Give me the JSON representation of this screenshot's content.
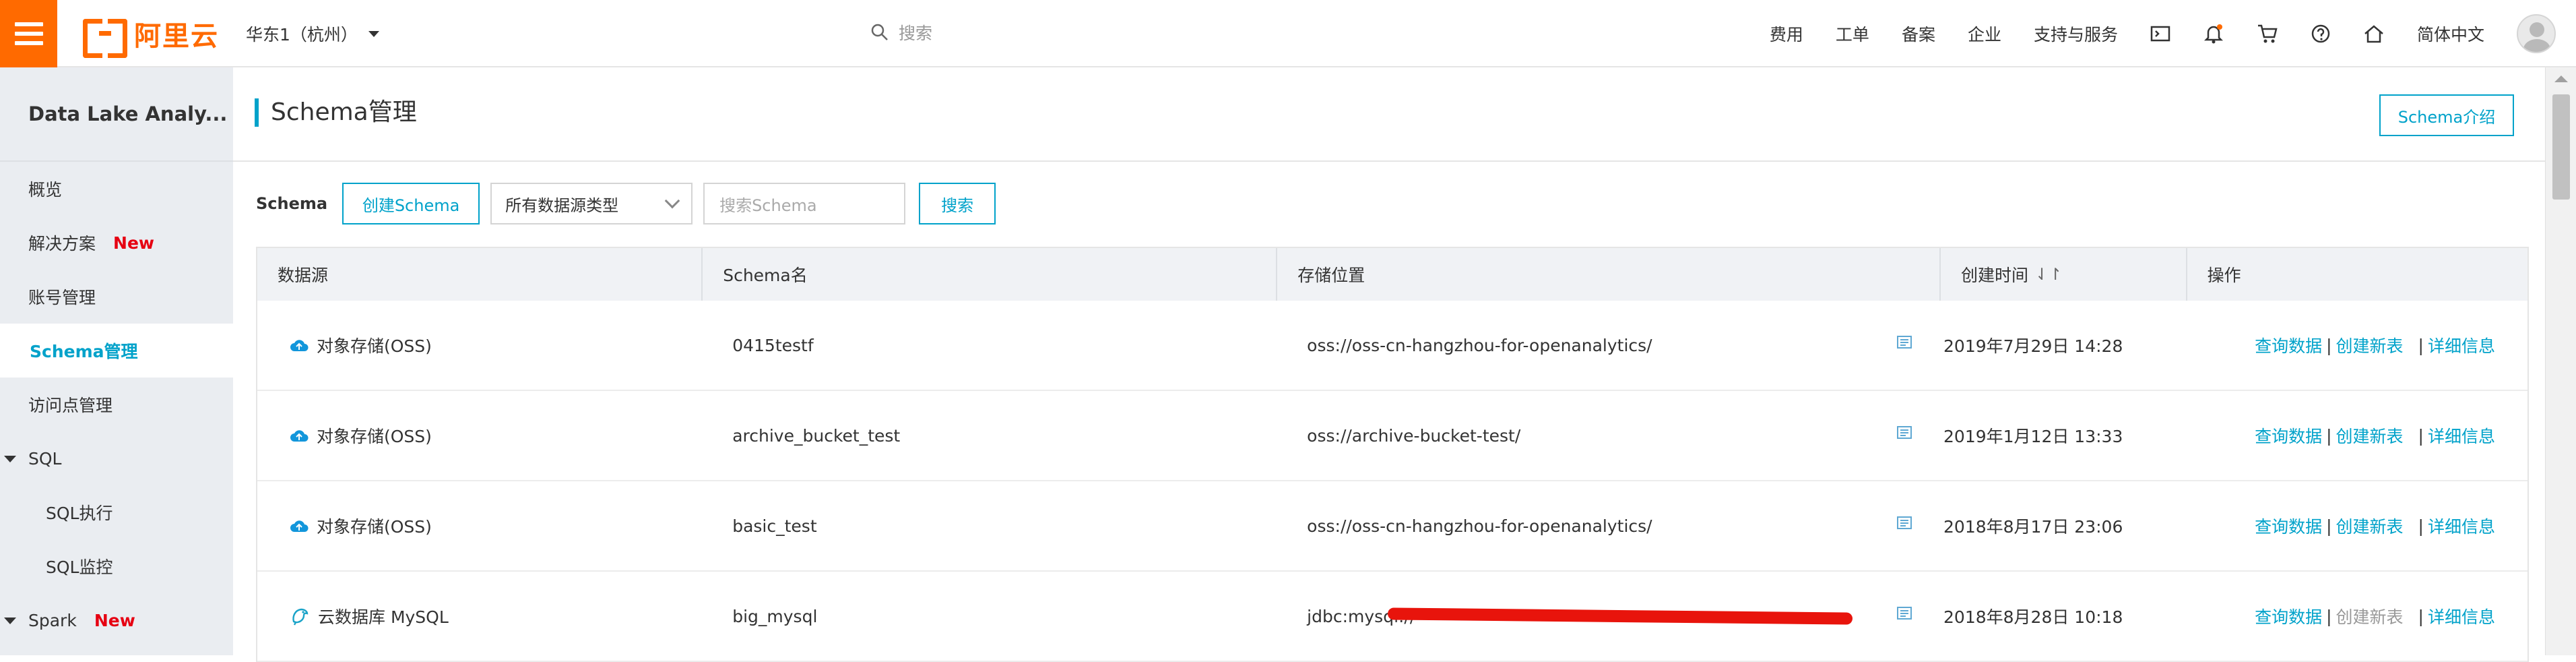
{
  "topbar": {
    "logo_text": "阿里云",
    "region": "华东1（杭州）",
    "search_placeholder": "搜索",
    "nav": [
      "费用",
      "工单",
      "备案",
      "企业",
      "支持与服务"
    ],
    "language": "简体中文",
    "brand_color": "#ff6a00"
  },
  "sidebar": {
    "title": "Data Lake Analy...",
    "items": [
      {
        "label": "概览"
      },
      {
        "label": "解决方案",
        "badge": "New"
      },
      {
        "label": "账号管理"
      },
      {
        "label": "Schema管理",
        "active": true
      },
      {
        "label": "访问点管理"
      },
      {
        "label": "SQL",
        "group": true
      },
      {
        "label": "SQL执行"
      },
      {
        "label": "SQL监控"
      },
      {
        "label": "Spark",
        "group": true,
        "badge": "New"
      }
    ]
  },
  "main": {
    "title": "Schema管理",
    "intro_button": "Schema介绍",
    "toolbar": {
      "label": "Schema",
      "create_button": "创建Schema",
      "type_select": "所有数据源类型",
      "search_placeholder": "搜索Schema",
      "search_button": "搜索"
    },
    "table": {
      "columns": [
        "数据源",
        "Schema名",
        "存储位置",
        "创建时间",
        "操作"
      ],
      "sort_icon": "⇃↾",
      "rows": [
        {
          "source": "对象存储(OSS)",
          "source_icon": "oss-cloud-icon",
          "schema": "0415testf",
          "location": "oss://oss-cn-hangzhou-for-openanalytics/",
          "created": "2019年7月29日 14:28",
          "actions": [
            "查询数据",
            "创建新表",
            "详细信息"
          ]
        },
        {
          "source": "对象存储(OSS)",
          "source_icon": "oss-cloud-icon",
          "schema": "archive_bucket_test",
          "location": "oss://archive-bucket-test/",
          "created": "2019年1月12日 13:33",
          "actions": [
            "查询数据",
            "创建新表",
            "详细信息"
          ]
        },
        {
          "source": "对象存储(OSS)",
          "source_icon": "oss-cloud-icon",
          "schema": "basic_test",
          "location": "oss://oss-cn-hangzhou-for-openanalytics/",
          "created": "2018年8月17日 23:06",
          "actions": [
            "查询数据",
            "创建新表",
            "详细信息"
          ]
        },
        {
          "source": "云数据库 MySQL",
          "source_icon": "mysql-dolphin-icon",
          "schema": "big_mysql",
          "location": "jdbc:mysql://",
          "created": "2018年8月28日 10:18",
          "actions": [
            "查询数据",
            "创建新表",
            "详细信息"
          ],
          "create_disabled": true
        }
      ]
    }
  },
  "colors": {
    "accent": "#00a2ca",
    "new_badge": "#e60012",
    "redaction": "#e8140c"
  }
}
